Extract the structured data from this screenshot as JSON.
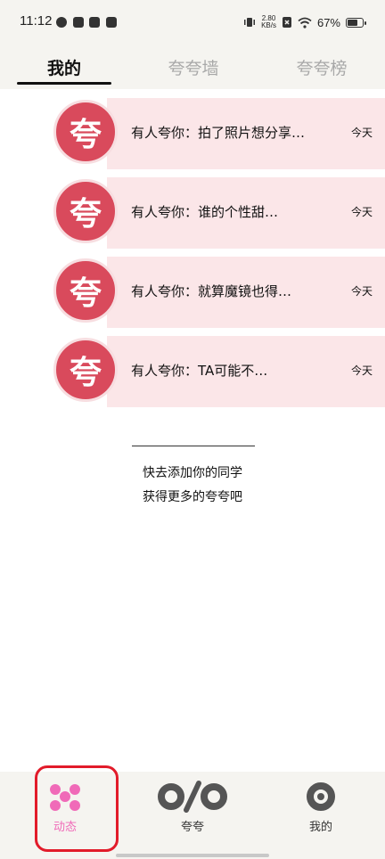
{
  "status_bar": {
    "time": "11:12",
    "net_speed_value": "2.80",
    "net_speed_unit": "KB/s",
    "battery": "67%"
  },
  "top_tabs": [
    {
      "label": "我的"
    },
    {
      "label": "夸夸墙"
    },
    {
      "label": "夸夸榜"
    }
  ],
  "feed": {
    "avatar_char": "夸",
    "items": [
      {
        "text": "有人夸你：拍了照片想分享…",
        "time": "今天"
      },
      {
        "text": "有人夸你：谁的个性甜…",
        "time": "今天"
      },
      {
        "text": "有人夸你：就算魔镜也得…",
        "time": "今天"
      },
      {
        "text": "有人夸你：TA可能不…",
        "time": "今天"
      }
    ]
  },
  "invite": {
    "line1": "快去添加你的同学",
    "line2": "获得更多的夸夸吧"
  },
  "bottom_nav": [
    {
      "label": "动态"
    },
    {
      "label": "夸夸"
    },
    {
      "label": "我的"
    }
  ],
  "colors": {
    "accent_pink": "#f06ab8",
    "avatar_red": "#d94a5c",
    "highlight_red": "#e21b2a",
    "card_pink": "#fbe6e8"
  }
}
